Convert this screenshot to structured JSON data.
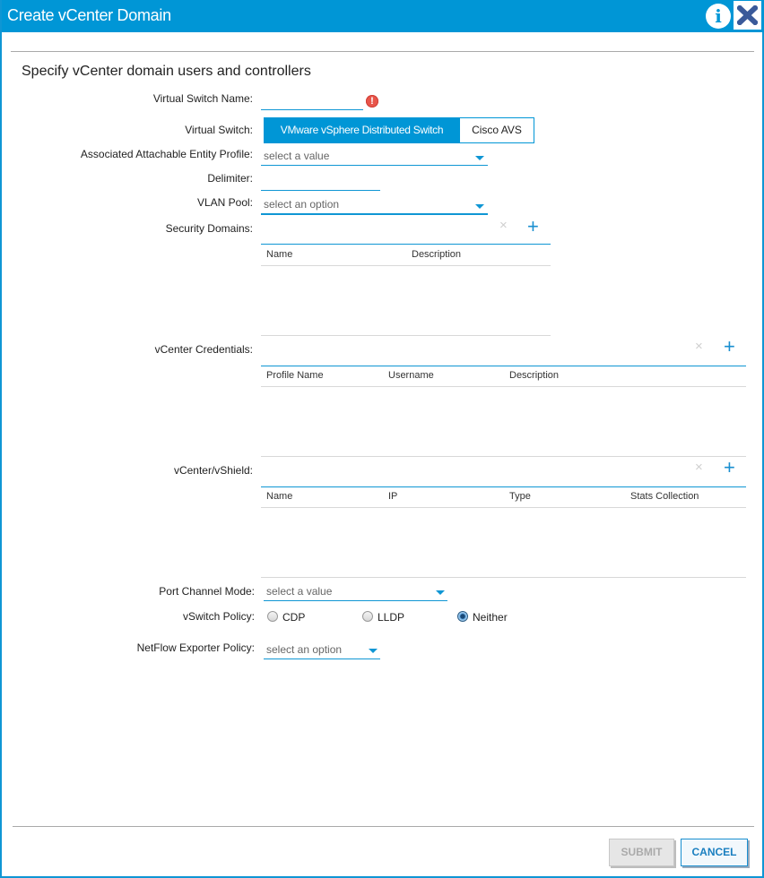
{
  "dialog": {
    "title": "Create vCenter Domain",
    "subtitle": "Specify vCenter domain users and controllers",
    "info_icon": "info-icon",
    "close_icon": "close-icon"
  },
  "form": {
    "virtual_switch_name": {
      "label": "Virtual Switch Name:",
      "value": "",
      "error_icon": "!"
    },
    "virtual_switch": {
      "label": "Virtual Switch:",
      "options": [
        "VMware vSphere Distributed Switch",
        "Cisco AVS"
      ],
      "selected": "VMware vSphere Distributed Switch"
    },
    "aep": {
      "label": "Associated Attachable Entity Profile:",
      "placeholder": "select a value"
    },
    "delimiter": {
      "label": "Delimiter:",
      "value": ""
    },
    "vlan_pool": {
      "label": "VLAN Pool:",
      "placeholder": "select an option"
    },
    "security_domains": {
      "label": "Security Domains:",
      "columns": [
        "Name",
        "Description"
      ],
      "rows": [],
      "delete_icon": "×",
      "add_icon": "+"
    },
    "vcenter_credentials": {
      "label": "vCenter Credentials:",
      "columns": [
        "Profile Name",
        "Username",
        "Description"
      ],
      "rows": [],
      "delete_icon": "×",
      "add_icon": "+"
    },
    "vcenter_vshield": {
      "label": "vCenter/vShield:",
      "columns": [
        "Name",
        "IP",
        "Type",
        "Stats Collection"
      ],
      "rows": [],
      "delete_icon": "×",
      "add_icon": "+"
    },
    "port_channel_mode": {
      "label": "Port Channel Mode:",
      "placeholder": "select a value"
    },
    "vswitch_policy": {
      "label": "vSwitch Policy:",
      "options": [
        "CDP",
        "LLDP",
        "Neither"
      ],
      "selected": "Neither"
    },
    "netflow_exporter_policy": {
      "label": "NetFlow Exporter Policy:",
      "placeholder": "select an option"
    }
  },
  "footer": {
    "submit_label": "SUBMIT",
    "cancel_label": "CANCEL"
  }
}
